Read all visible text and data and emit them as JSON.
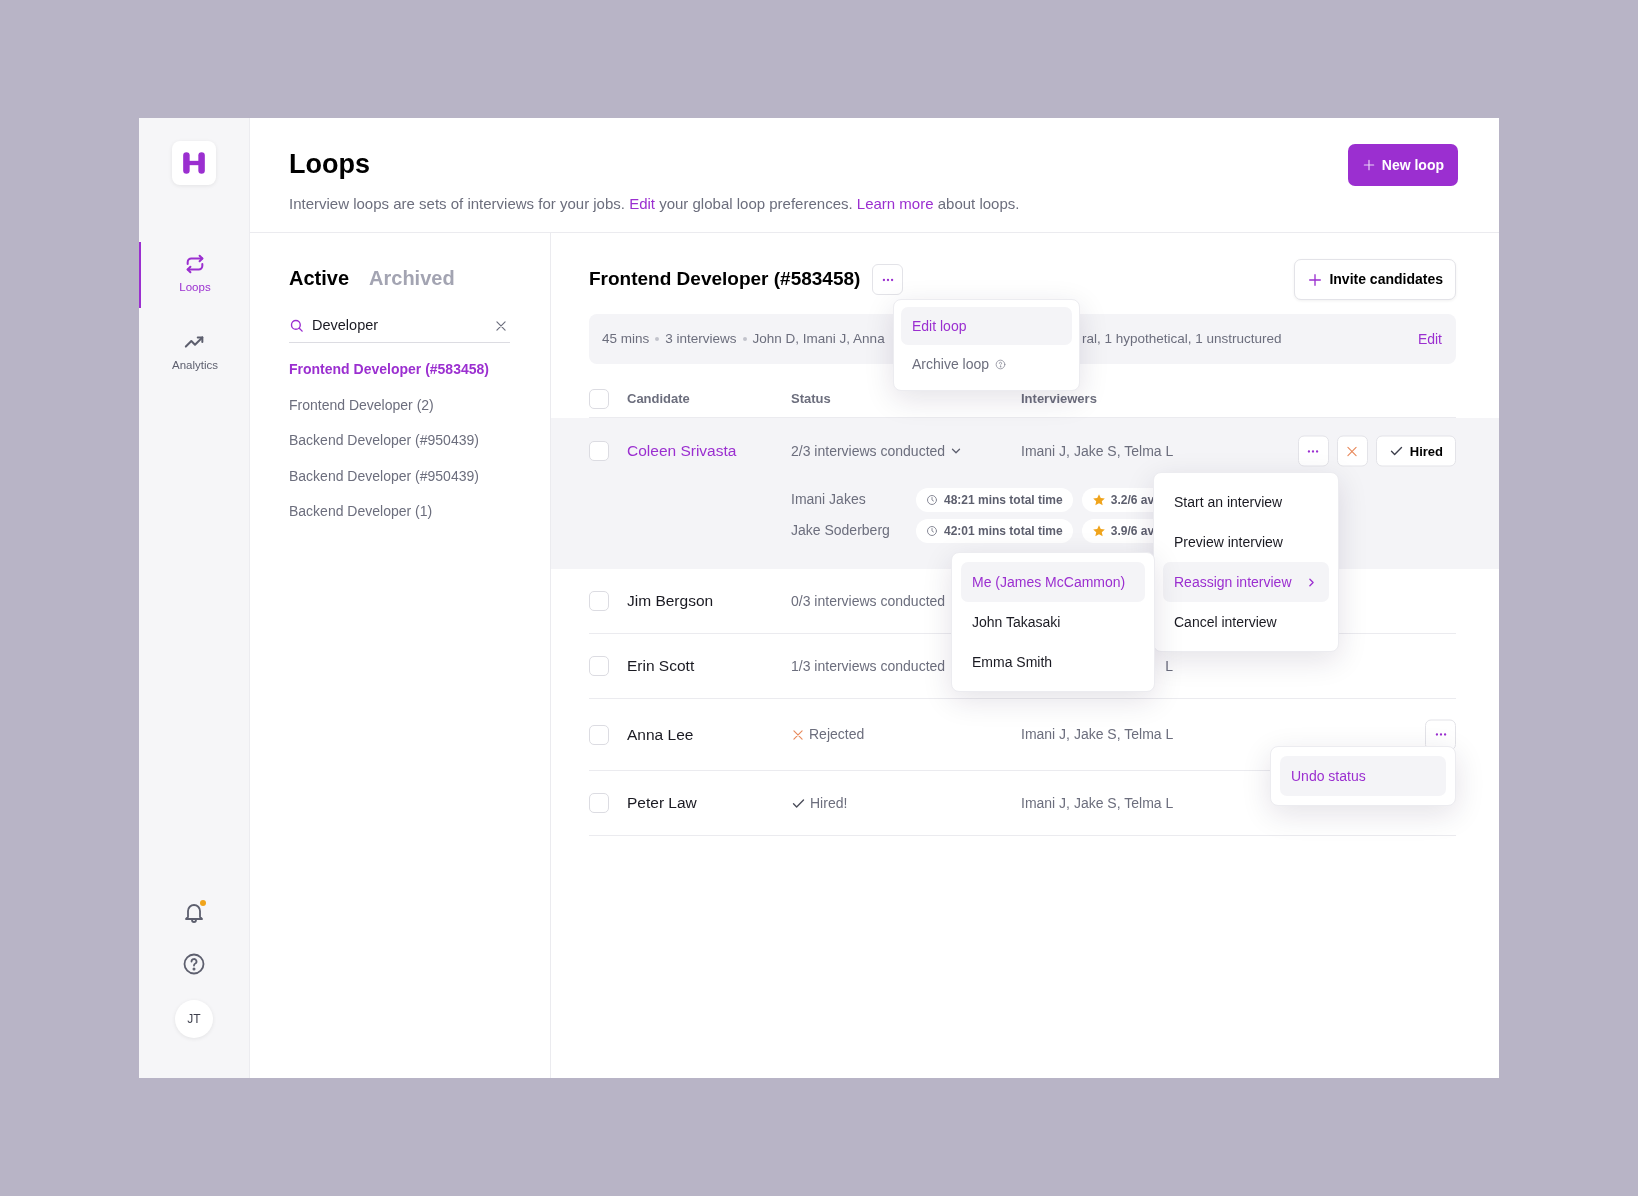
{
  "sidebar": {
    "nav": [
      {
        "label": "Loops",
        "selected": true
      },
      {
        "label": "Analytics",
        "selected": false
      }
    ],
    "notifications": {
      "unread": true
    },
    "avatar": "JT"
  },
  "header": {
    "title": "Loops",
    "description": [
      {
        "text": "Interview loops are sets of interviews for your jobs. ",
        "kind": "text"
      },
      {
        "text": "Edit",
        "kind": "link"
      },
      {
        "text": " your global loop preferences. ",
        "kind": "text"
      },
      {
        "text": "Learn more",
        "kind": "link"
      },
      {
        "text": " about loops.",
        "kind": "text"
      }
    ],
    "new_button": "New loop"
  },
  "loop_list": {
    "tabs": [
      {
        "label": "Active",
        "selected": true
      },
      {
        "label": "Archived",
        "selected": false
      }
    ],
    "search": {
      "value": "Developer"
    },
    "items": [
      {
        "label": "Frontend Developer (#583458)",
        "selected": true
      },
      {
        "label": "Frontend Developer (2)",
        "selected": false
      },
      {
        "label": "Backend Developer (#950439)",
        "selected": false
      },
      {
        "label": "Backend Developer (#950439)",
        "selected": false
      },
      {
        "label": "Backend Developer (1)",
        "selected": false
      }
    ]
  },
  "loop": {
    "title": "Frontend Developer (#583458)",
    "invite_button": "Invite candidates",
    "summary": {
      "parts": [
        "45 mins",
        "3 interviews",
        "John D, Imani J, Anna"
      ],
      "tail": "ral, 1 hypothetical, 1 unstructured",
      "edit": "Edit"
    },
    "table": {
      "select_all_checked": false,
      "columns": [
        "Candidate",
        "Status",
        "Interviewers"
      ],
      "rows": [
        {
          "name": "Coleen Srivasta",
          "checked": false,
          "highlighted": true,
          "status": {
            "kind": "progress",
            "text": "2/3 interviews conducted"
          },
          "expanded": true,
          "interviewers": "Imani J, Jake S, Telma L",
          "interviewers_tail": false,
          "interviews": [
            {
              "interviewer": "Imani Jakes",
              "time": "48:21 mins total time",
              "rating": "3.2/6 av"
            },
            {
              "interviewer": "Jake Soderberg",
              "time": "42:01 mins total time",
              "rating": "3.9/6 av"
            }
          ],
          "menu_button": true,
          "decision_buttons": true,
          "hire_label": "Hired"
        },
        {
          "name": "Jim Bergson",
          "checked": false,
          "highlighted": false,
          "status": {
            "kind": "progress",
            "text": "0/3 interviews conducted"
          },
          "expanded": false,
          "menu_button": false,
          "decision_buttons": false
        },
        {
          "name": "Erin Scott",
          "checked": false,
          "highlighted": false,
          "status": {
            "kind": "progress",
            "text": "1/3 interviews conducted"
          },
          "expanded": false,
          "interviewers": "L",
          "interviewers_tail": true,
          "menu_button": false,
          "decision_buttons": false
        },
        {
          "name": "Anna Lee",
          "checked": false,
          "highlighted": false,
          "status": {
            "kind": "rejected",
            "text": "Rejected"
          },
          "expanded": false,
          "interviewers": "Imani J, Jake S, Telma L",
          "interviewers_tail": false,
          "menu_button": true,
          "decision_buttons": false
        },
        {
          "name": "Peter Law",
          "checked": false,
          "highlighted": false,
          "status": {
            "kind": "hired",
            "text": "Hired!"
          },
          "expanded": false,
          "interviewers": "Imani J, Jake S, Telma L",
          "interviewers_tail": false,
          "menu_button": false,
          "decision_buttons": false
        }
      ]
    }
  },
  "menus": {
    "loop_menu": [
      {
        "label": "Edit loop",
        "selected": true
      },
      {
        "label": "Archive loop",
        "selected": false,
        "help": true
      }
    ],
    "row_menu": [
      {
        "label": "Start an interview",
        "selected": false
      },
      {
        "label": "Preview interview",
        "selected": false
      },
      {
        "label": "Reassign interview",
        "selected": true,
        "submenu": true
      },
      {
        "label": "Cancel interview",
        "selected": false
      }
    ],
    "reassign_menu": [
      {
        "label": "Me (James McCammon)",
        "selected": true
      },
      {
        "label": "John Takasaki",
        "selected": false
      },
      {
        "label": "Emma Smith",
        "selected": false
      }
    ],
    "status_menu": [
      {
        "label": "Undo status",
        "selected": true
      }
    ]
  }
}
